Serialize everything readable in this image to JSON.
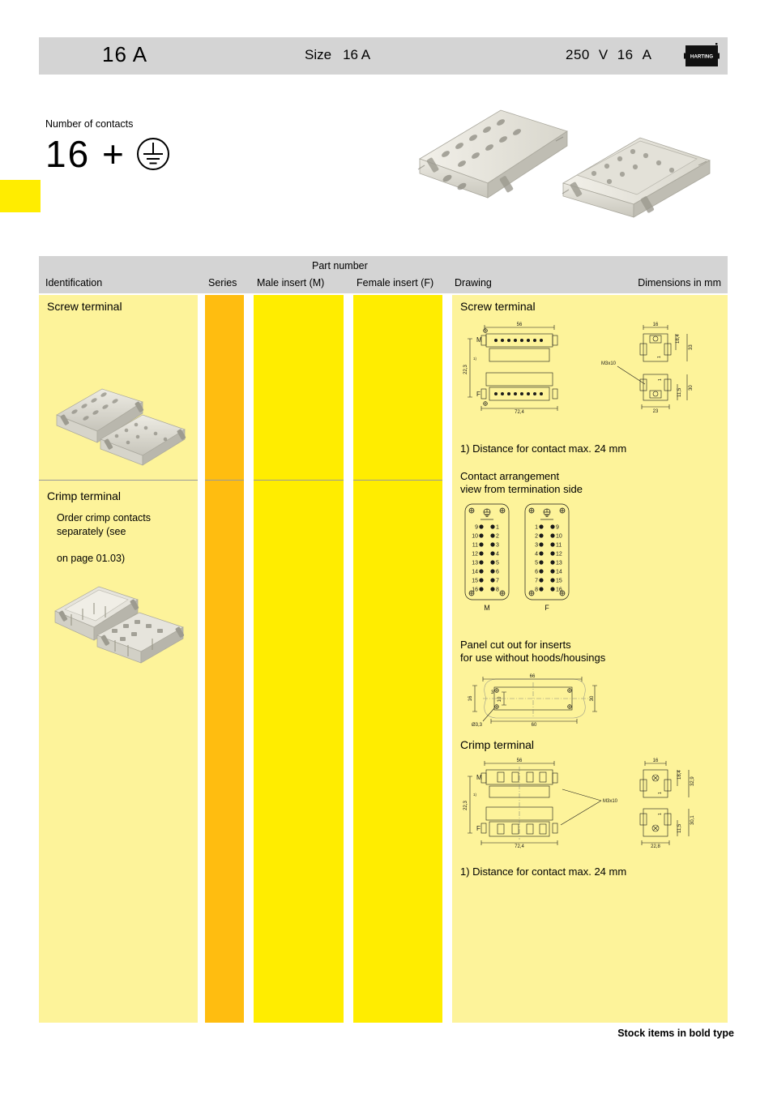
{
  "header": {
    "left_rating": "16 A",
    "size_label": "Size",
    "size_value": "16 A",
    "voltage": "250",
    "voltage_unit": "V",
    "current": "16",
    "current_unit": "A",
    "brand": "HARTING"
  },
  "contacts": {
    "label": "Number of contacts",
    "value": "16 +",
    "earth_symbol": "earth-ground-symbol"
  },
  "table": {
    "headers": {
      "identification": "Identification",
      "series": "Series",
      "part_number": "Part number",
      "male_insert": "Male insert (M)",
      "female_insert": "Female insert (F)",
      "drawing": "Drawing",
      "dimensions": "Dimensions in mm"
    },
    "rows": [
      {
        "identification": "Screw terminal",
        "series": "",
        "male_insert": "",
        "female_insert": ""
      },
      {
        "identification": "Crimp terminal",
        "note_line1": "Order crimp contacts",
        "note_line2": "separately (see",
        "note_line3": "on page 01.03)",
        "series": "",
        "male_insert": "",
        "female_insert": ""
      }
    ]
  },
  "drawings": {
    "screw": {
      "title": "Screw terminal",
      "footnote": "1) Distance for contact max. 24 mm",
      "labels": {
        "male": "M",
        "female": "F",
        "thread": "M3x10"
      },
      "dimensions": {
        "width_top": "56",
        "width_bottom": "72,4",
        "side_width": "16",
        "side_width_bottom": "23",
        "height_left": "22,3",
        "height_left_note": "1)",
        "side_h1": "18,4",
        "side_h2": "33",
        "side_h3": "1",
        "side_h4": "30",
        "side_h5": "11,5"
      }
    },
    "arrangement": {
      "title_line1": "Contact arrangement",
      "title_line2": "view from termination side",
      "male_label": "M",
      "female_label": "F",
      "male_left_column": [
        "9",
        "10",
        "11",
        "12",
        "13",
        "14",
        "15",
        "16"
      ],
      "male_right_column": [
        "1",
        "2",
        "3",
        "4",
        "5",
        "6",
        "7",
        "8"
      ],
      "female_left_column": [
        "1",
        "2",
        "3",
        "4",
        "5",
        "6",
        "7",
        "8"
      ],
      "female_right_column": [
        "9",
        "10",
        "11",
        "12",
        "13",
        "14",
        "15",
        "16"
      ]
    },
    "panel_cutout": {
      "title_line1": "Panel cut out for inserts",
      "title_line2": "for use without hoods/housings",
      "dimensions": {
        "width_top": "66",
        "width_bottom": "60",
        "height_left": "16",
        "inner": "10",
        "offset": "3",
        "hole": "ø3,3",
        "height_right": "30"
      }
    },
    "crimp": {
      "title": "Crimp terminal",
      "footnote": "1) Distance for contact max. 24 mm",
      "labels": {
        "male": "M",
        "female": "F",
        "thread": "M3x10"
      },
      "dimensions": {
        "width_top": "56",
        "width_bottom": "72,4",
        "side_width": "16",
        "side_width_bottom": "22,8",
        "height_left": "22,3",
        "height_left_note": "1)",
        "side_h1": "18,4",
        "side_h2": "32,9",
        "side_h3": "1",
        "side_h4": "30,1",
        "side_h5": "11,5"
      }
    }
  },
  "footer": {
    "stock_note": "Stock items in bold type"
  }
}
